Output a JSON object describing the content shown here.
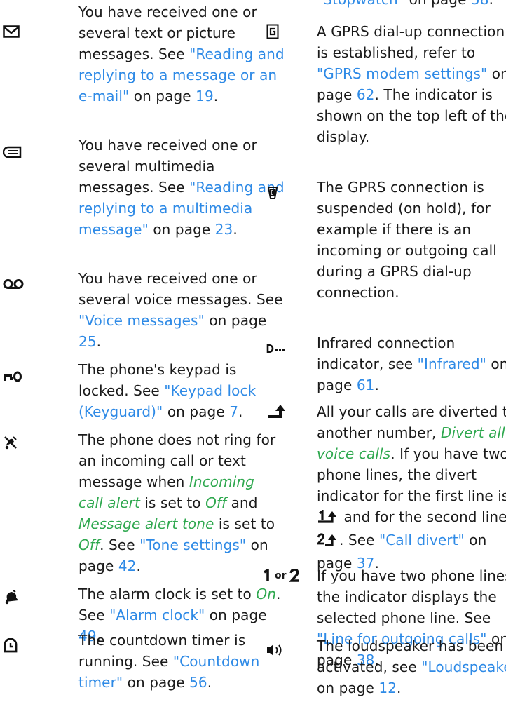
{
  "header_cutoff": {
    "link": "\"Stopwatch\"",
    "rest": " on page ",
    "page": "58",
    "end": "."
  },
  "left_entries": [
    {
      "icon": "envelope-icon",
      "l1": "You have received one or",
      "l2": "several text or picture",
      "l3a": "messages. See ",
      "l3b": "\"Reading and",
      "l4": "replying to a message or an",
      "l5a": "e-mail\"",
      "l5b": " on page ",
      "l5c": "19",
      "l5d": "."
    },
    {
      "icon": "mms-icon",
      "l1": "You have received one or",
      "l2": "several multimedia",
      "l3a": "messages. See ",
      "l3b": "\"Reading and",
      "l4": "replying to a multimedia",
      "l5a": "message\"",
      "l5b": " on page ",
      "l5c": "23",
      "l5d": "."
    },
    {
      "icon": "voicemail-icon",
      "l1": "You have received one or",
      "l2": "several voice messages. See",
      "l3a": "\"Voice messages\"",
      "l3b": " on page",
      "l4a": "25",
      "l4b": "."
    },
    {
      "icon": "key-icon",
      "l1": "The phone's keypad is",
      "l2a": "locked. See ",
      "l2b": "\"Keypad lock",
      "l3a": "(Keyguard)\"",
      "l3b": " on page ",
      "l3c": "7",
      "l3d": "."
    },
    {
      "icon": "silent-icon",
      "l1": "The phone does not ring for",
      "l2": "an incoming call or text",
      "l3a": "message when ",
      "l3b": "Incoming",
      "l4a": "call alert",
      "l4b": " is set to ",
      "l4c": "Off",
      "l4d": " and",
      "l5a": "Message alert tone",
      "l5b": " is set to",
      "l6a": "Off",
      "l6b": ". See ",
      "l6c": "\"Tone settings\"",
      "l6d": " on",
      "l7a": "page ",
      "l7b": "42",
      "l7c": "."
    },
    {
      "icon": "alarm-bell-icon",
      "l1a": "The alarm clock is set to ",
      "l1b": "On",
      "l1c": ".",
      "l2a": "See ",
      "l2b": "\"Alarm clock\"",
      "l2c": " on page",
      "l3a": "49",
      "l3b": "."
    },
    {
      "icon": "countdown-clock-icon",
      "l1": "The countdown timer is",
      "l2a": "running. See ",
      "l2b": "\"Countdown",
      "l3a": "timer\"",
      "l3b": " on page ",
      "l3c": "56",
      "l3d": "."
    }
  ],
  "right_entries": [
    {
      "icon": "gprs-icon",
      "l1": "A GPRS dial-up connection",
      "l2": "is established, refer to",
      "l3a": "\"GPRS modem settings\"",
      "l3b": " on",
      "l4a": "page ",
      "l4b": "62",
      "l4c": ". The indicator is",
      "l5": "shown on the top left of the",
      "l6": "display."
    },
    {
      "icon": "gprs-suspended-icon",
      "l1": "The GPRS connection is",
      "l2": "suspended (on hold), for",
      "l3": "example if there is an",
      "l4": "incoming or outgoing call",
      "l5": "during a GPRS dial-up",
      "l6": "connection."
    },
    {
      "icon": "infrared-icon",
      "l1": "Infrared connection",
      "l2a": "indicator, see ",
      "l2b": "\"Infrared\"",
      "l2c": " on",
      "l3a": "page ",
      "l3b": "61",
      "l3c": "."
    },
    {
      "icon": "divert-icon",
      "l1": "All your calls are diverted to",
      "l2a": "another number, ",
      "l2b": "Divert all",
      "l3a": "voice calls",
      "l3b": ". If you have two",
      "l4": "phone lines, the divert",
      "l5": "indicator for the first line is",
      "l6": " and for the second line",
      "l7a": ". See ",
      "l7b": "\"Call divert\"",
      "l7c": " on",
      "l8a": "page ",
      "l8b": "37",
      "l8c": "."
    },
    {
      "icon": "line-1-or-2-icon",
      "icon_or": "or",
      "l1": "If you have two phone lines,",
      "l2": "the indicator displays the",
      "l3": "selected phone line. See",
      "l4a": "\"Line for outgoing calls\"",
      "l4b": " on",
      "l5a": "page ",
      "l5b": "38",
      "l5c": "."
    },
    {
      "icon": "loudspeaker-icon",
      "l1": "The loudspeaker has been",
      "l2a": "activated, see ",
      "l2b": "\"Loudspeaker\"",
      "l3a": "on page ",
      "l3b": "12",
      "l3c": "."
    }
  ],
  "colors": {
    "link": "#2e8ae6",
    "emphasis": "#2fa84f",
    "text": "#1a1a1a"
  }
}
